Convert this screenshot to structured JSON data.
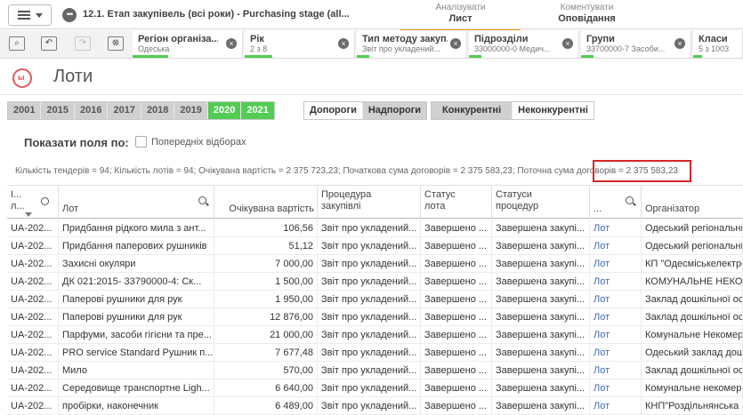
{
  "app": {
    "title": "12.1. Етап закупівель (всі роки) - Purchasing stage (all...",
    "tabs": [
      {
        "small": "Аналізувати",
        "big": "Лист"
      },
      {
        "small": "Коментувати",
        "big": "Оповідання"
      }
    ]
  },
  "selections": [
    {
      "name": "Регіон організа...",
      "value": "Одеська"
    },
    {
      "name": "Рік",
      "value": "2 з 8"
    },
    {
      "name": "Тип методу закуп...",
      "value": "Звіт про укладений..."
    },
    {
      "name": "Підрозділи",
      "value": "33000000-0 Медич..."
    },
    {
      "name": "Групи",
      "value": "33700000-7 Засоби..."
    },
    {
      "name": "Класи",
      "value": "5 з 1003"
    }
  ],
  "sheet": {
    "title": "Лоти",
    "logo_text": "ы"
  },
  "years": [
    {
      "label": "2001",
      "selected": false
    },
    {
      "label": "2015",
      "selected": false
    },
    {
      "label": "2016",
      "selected": false
    },
    {
      "label": "2017",
      "selected": false
    },
    {
      "label": "2018",
      "selected": false
    },
    {
      "label": "2019",
      "selected": false
    },
    {
      "label": "2020",
      "selected": true
    },
    {
      "label": "2021",
      "selected": true
    }
  ],
  "thresholds": [
    "Допороги",
    "Надпороги"
  ],
  "competitive": [
    "Конкурентні",
    "Неконкурентні"
  ],
  "show_fields": {
    "label": "Показати поля по:",
    "checkbox_label": "Попередніх відборах"
  },
  "summary": "Кількість тендерів = 94; Кількість лотів = 94; Очікувана вартість = 2 375 723,23; Початкова сума договорів = 2 375 583,23; Поточна сума договорів = 2 375 583,23",
  "table": {
    "headers": [
      "І...\nл...",
      "Лот",
      "Очікувана вартість",
      "Процедура\nзакупівлі",
      "Статус\nлота",
      "Статуси\nпроцедур",
      "...",
      "Організатор"
    ],
    "rows": [
      [
        "UA-202...",
        "Придбання рідкого мила з ант...",
        "106,56",
        "Звіт про укладений...",
        "Завершено ...",
        "Завершена закупі...",
        "Лот",
        "Одеський регіональни"
      ],
      [
        "UA-202...",
        "Придбання паперових рушників",
        "51,12",
        "Звіт про укладений...",
        "Завершено ...",
        "Завершена закупі...",
        "Лот",
        "Одеський регіональни"
      ],
      [
        "UA-202...",
        "Захисні окуляри",
        "7 000,00",
        "Звіт про укладений...",
        "Завершено ...",
        "Завершена закупі...",
        "Лот",
        "КП \"Одесміськелектро"
      ],
      [
        "UA-202...",
        "ДК 021:2015- 33790000-4: Ск...",
        "1 500,00",
        "Звіт про укладений...",
        "Завершено ...",
        "Завершена закупі...",
        "Лот",
        "КОМУНАЛЬНЕ НЕКОМ"
      ],
      [
        "UA-202...",
        "Паперові рушники для рук",
        "1 950,00",
        "Звіт про укладений...",
        "Завершено ...",
        "Завершена закупі...",
        "Лот",
        "Заклад дошкільної осв"
      ],
      [
        "UA-202...",
        "Паперові рушники для рук",
        "12 876,00",
        "Звіт про укладений...",
        "Завершено ...",
        "Завершена закупі...",
        "Лот",
        "Заклад дошкільної осв"
      ],
      [
        "UA-202...",
        "Парфуми, засоби гігієни та пре...",
        "21 000,00",
        "Звіт про укладений...",
        "Завершено ...",
        "Завершена закупі...",
        "Лот",
        "Комунальне Некомерц"
      ],
      [
        "UA-202...",
        "PRO service Standard Рушник п...",
        "7 677,48",
        "Звіт про укладений...",
        "Завершено ...",
        "Завершена закупі...",
        "Лот",
        "Одеський заклад дошк"
      ],
      [
        "UA-202...",
        "Мило",
        "570,00",
        "Звіт про укладений...",
        "Завершено ...",
        "Завершена закупі...",
        "Лот",
        "Заклад дошкільної осв"
      ],
      [
        "UA-202...",
        "Середовище транспортне Ligh...",
        "6 640,00",
        "Звіт про укладений...",
        "Завершено ...",
        "Завершена закупі...",
        "Лот",
        "Комунальне некомерц"
      ],
      [
        "UA-202...",
        "пробірки, наконечник",
        "6 489,00",
        "Звіт про укладений...",
        "Завершено ...",
        "Завершена закупі...",
        "Лот",
        "КНП\"Роздільнянська б"
      ]
    ]
  },
  "colors": {
    "accent_green": "#52cc52",
    "highlight_red": "#d62728",
    "link_blue": "#3c6ab8",
    "tab_underline": "#f5a623"
  }
}
